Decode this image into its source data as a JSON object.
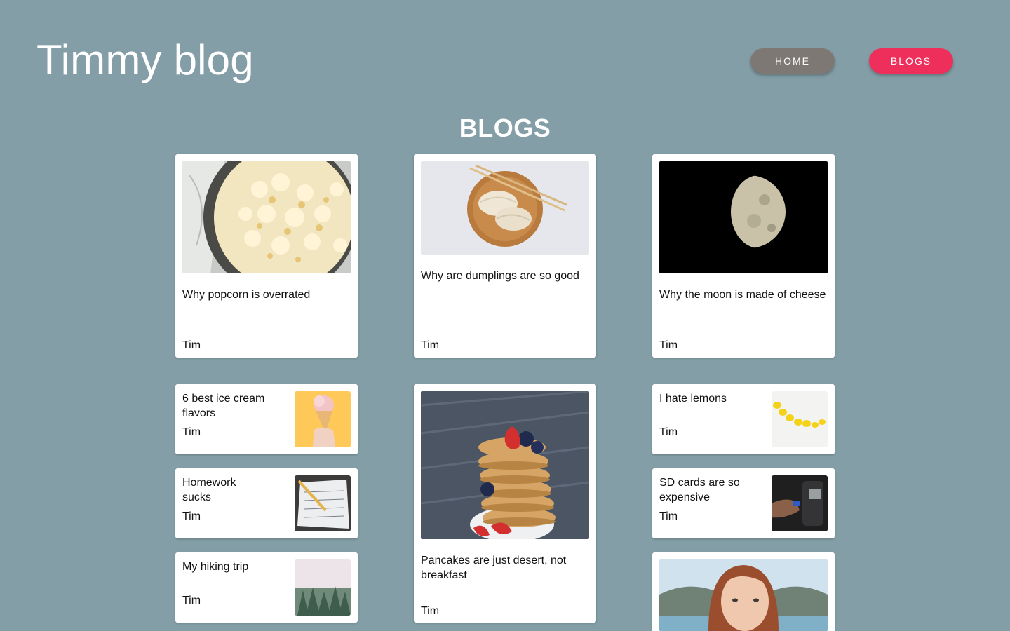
{
  "header": {
    "site_title": "Timmy blog",
    "nav": {
      "home_label": "HOME",
      "blogs_label": "BLOGS"
    }
  },
  "main": {
    "section_title": "BLOGS",
    "posts": [
      {
        "title": "Why popcorn is overrated",
        "author": "Tim"
      },
      {
        "title": "Why are dumplings are so good",
        "author": "Tim"
      },
      {
        "title": "Why the moon is made of cheese",
        "author": "Tim"
      },
      {
        "title": "6 best ice cream flavors",
        "author": "Tim"
      },
      {
        "title": "Pancakes are just desert, not breakfast",
        "author": "Tim"
      },
      {
        "title": "I hate lemons",
        "author": "Tim"
      },
      {
        "title": "Homework sucks",
        "author": "Tim"
      },
      {
        "title": "SD cards are so expensive",
        "author": "Tim"
      },
      {
        "title": "My hiking trip",
        "author": "Tim"
      }
    ]
  },
  "colors": {
    "background": "#839ea6",
    "nav_home": "#7e7875",
    "nav_blogs_active": "#ef2f5b"
  }
}
